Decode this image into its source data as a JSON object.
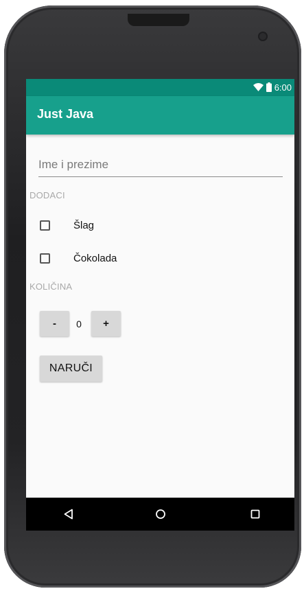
{
  "status_bar": {
    "time": "6:00",
    "icons": [
      "wifi-icon",
      "battery-icon"
    ]
  },
  "app_bar": {
    "title": "Just Java"
  },
  "form": {
    "name_placeholder": "Ime i prezime",
    "name_value": ""
  },
  "toppings": {
    "section_label": "DODACI",
    "items": [
      {
        "label": "Šlag",
        "checked": false
      },
      {
        "label": "Čokolada",
        "checked": false
      }
    ]
  },
  "quantity": {
    "section_label": "KOLIČINA",
    "decrement_label": "-",
    "increment_label": "+",
    "value": "0"
  },
  "order": {
    "button_label": "NARUČI"
  },
  "nav_bar": {
    "icons": [
      "back-icon",
      "home-icon",
      "recents-icon"
    ]
  },
  "colors": {
    "status_bar": "#0a8a78",
    "app_bar": "#17a08c",
    "screen_bg": "#fafafa",
    "button_bg": "#d8d8d8"
  }
}
